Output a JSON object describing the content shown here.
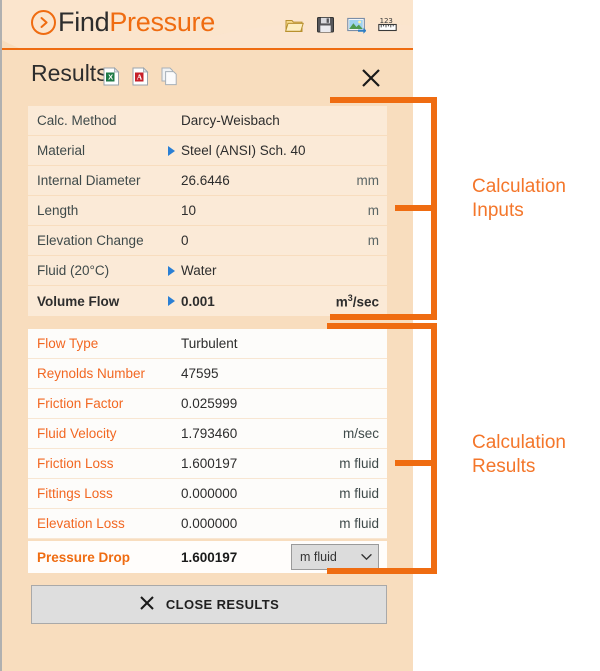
{
  "brand": {
    "first": "Find",
    "second": "Pressure",
    "mark_icon": "chevron-right-circle-icon"
  },
  "titlebar": {
    "tools": [
      {
        "name": "open-folder-icon",
        "label": "Open"
      },
      {
        "name": "save-disk-icon",
        "label": "Save"
      },
      {
        "name": "export-image-icon",
        "label": "Export Image"
      },
      {
        "name": "units-ruler-icon",
        "label": "Units"
      }
    ]
  },
  "results_header": {
    "title": "Results",
    "doc_icons": [
      {
        "name": "excel-export-icon",
        "label": "Excel"
      },
      {
        "name": "pdf-export-icon",
        "label": "PDF"
      },
      {
        "name": "copy-icon",
        "label": "Copy"
      }
    ],
    "close_label": "Close"
  },
  "inputs": {
    "rows": [
      {
        "label": "Calc. Method",
        "caret": false,
        "value": "Darcy-Weisbach",
        "unit": "",
        "bold": false
      },
      {
        "label": "Material",
        "caret": true,
        "value": "Steel (ANSI) Sch.  40",
        "unit": "",
        "bold": false
      },
      {
        "label": "Internal Diameter",
        "caret": false,
        "value": "26.6446",
        "unit": "mm",
        "bold": false
      },
      {
        "label": "Length",
        "caret": false,
        "value": "10",
        "unit": "m",
        "bold": false
      },
      {
        "label": "Elevation Change",
        "caret": false,
        "value": "0",
        "unit": "m",
        "bold": false
      },
      {
        "label": "Fluid (20°C)",
        "caret": true,
        "value": "Water",
        "unit": "",
        "bold": false
      },
      {
        "label": "Volume Flow",
        "caret": true,
        "value": "0.001",
        "unit": "m3/sec",
        "unit_base": "m",
        "unit_sup": "3",
        "unit_tail": "/sec",
        "bold": true
      }
    ]
  },
  "results": {
    "rows": [
      {
        "label": "Flow Type",
        "value": "Turbulent",
        "unit": ""
      },
      {
        "label": "Reynolds Number",
        "value": "47595",
        "unit": ""
      },
      {
        "label": "Friction Factor",
        "value": "0.025999",
        "unit": ""
      },
      {
        "label": "Fluid Velocity",
        "value": "1.793460",
        "unit": "m/sec"
      },
      {
        "label": "Friction Loss",
        "value": "1.600197",
        "unit": "m fluid"
      },
      {
        "label": "Fittings Loss",
        "value": "0.000000",
        "unit": "m fluid"
      },
      {
        "label": "Elevation Loss",
        "value": "0.000000",
        "unit": "m fluid"
      }
    ],
    "pressure_drop": {
      "label": "Pressure Drop",
      "value": "1.600197",
      "unit_selected": "m fluid"
    }
  },
  "footer": {
    "close_results_label": "CLOSE RESULTS",
    "close_icon": "x-icon"
  },
  "annotations": [
    {
      "name": "calculation-inputs",
      "line1": "Calculation",
      "line2": "Inputs"
    },
    {
      "name": "calculation-results",
      "line1": "Calculation",
      "line2": "Results"
    }
  ],
  "colors": {
    "accent": "#ef6c11",
    "annotation": "#f4762a",
    "panel_bg": "#f8ddbe",
    "row_input_bg": "#fbead7",
    "row_result_bg": "#fdfcfa"
  }
}
